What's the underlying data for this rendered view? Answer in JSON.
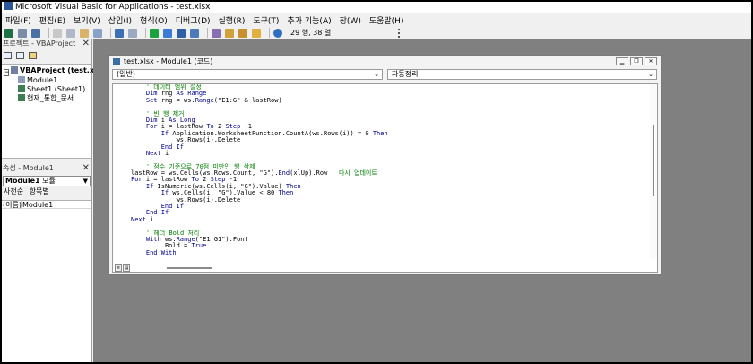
{
  "window": {
    "title": "Microsoft Visual Basic for Applications - test.xlsx"
  },
  "menu": [
    "파일(F)",
    "편집(E)",
    "보기(V)",
    "삽입(I)",
    "형식(O)",
    "디버그(D)",
    "실행(R)",
    "도구(T)",
    "추가 기능(A)",
    "창(W)",
    "도움말(H)"
  ],
  "toolbar": {
    "cursor_position": "29 행, 38 열"
  },
  "project_pane": {
    "title": "프로젝트 - VBAProject",
    "tree": [
      "VBAProject (test.xls",
      "Module1",
      "Sheet1 (Sheet1)",
      "현재_통합_문서"
    ]
  },
  "properties_pane": {
    "title": "속성 - Module1",
    "object_bold": "Module1",
    "object_type": "모듈",
    "tabs": [
      "사전순",
      "항목별"
    ],
    "row_key": "(이름)",
    "row_value": "Module1"
  },
  "code_window": {
    "title": "test.xlsx - Module1 (코드)",
    "object_combo": "(일반)",
    "procedure_combo": "자동정리",
    "lines": [
      {
        "text": "    ' 데이터 범위 설정",
        "comment": true
      },
      {
        "text": "    Dim rng As Range",
        "comment": false
      },
      {
        "text": "    Set rng = ws.Range(\"E1:G\" & lastRow)",
        "comment": false
      },
      {
        "text": "",
        "comment": false
      },
      {
        "text": "    ' 빈 행 제거",
        "comment": true
      },
      {
        "text": "    Dim i As Long",
        "comment": false
      },
      {
        "text": "    For i = lastRow To 2 Step -1",
        "comment": false
      },
      {
        "text": "        If Application.WorksheetFunction.CountA(ws.Rows(i)) = 0 Then",
        "comment": false
      },
      {
        "text": "            ws.Rows(i).Delete",
        "comment": false
      },
      {
        "text": "        End If",
        "comment": false
      },
      {
        "text": "    Next i",
        "comment": false
      },
      {
        "text": "",
        "comment": false
      },
      {
        "text": "    ' 점수 기준으로 70점 미만인 행 삭제",
        "comment": true
      },
      {
        "text": "lastRow = ws.Cells(ws.Rows.Count, \"G\").End(xlUp).Row ' 다시 업데이트",
        "comment": false
      },
      {
        "text": "For i = lastRow To 2 Step -1",
        "comment": false
      },
      {
        "text": "    If IsNumeric(ws.Cells(i, \"G\").Value) Then",
        "comment": false
      },
      {
        "text": "        If ws.Cells(i, \"G\").Value < 80 Then",
        "comment": false
      },
      {
        "text": "            ws.Rows(i).Delete",
        "comment": false
      },
      {
        "text": "        End If",
        "comment": false
      },
      {
        "text": "    End If",
        "comment": false
      },
      {
        "text": "Next i",
        "comment": false
      },
      {
        "text": "",
        "comment": false
      },
      {
        "text": "    ' 헤더 Bold 처리",
        "comment": true
      },
      {
        "text": "    With ws.Range(\"E1:G1\").Font",
        "comment": false
      },
      {
        "text": "        .Bold = True",
        "comment": false
      },
      {
        "text": "    End With",
        "comment": false
      }
    ]
  },
  "colors": {
    "comment": "#008000",
    "keyword": "#00008b",
    "workspace": "#808080"
  }
}
